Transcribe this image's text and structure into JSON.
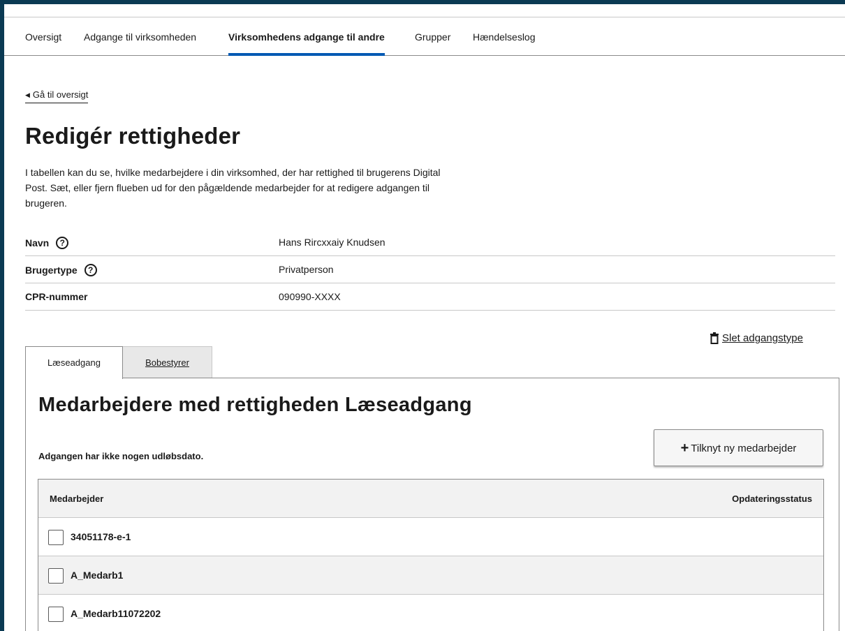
{
  "nav": {
    "tabs": [
      {
        "label": "Oversigt"
      },
      {
        "label": "Adgange til virksomheden"
      },
      {
        "label": "Virksomhedens adgange til andre"
      },
      {
        "label": "Grupper"
      },
      {
        "label": "Hændelseslog"
      }
    ],
    "active_index": 2
  },
  "back_link": "Gå til oversigt",
  "page_title": "Redigér rettigheder",
  "intro": "I tabellen kan du se, hvilke medarbejdere i din virksomhed, der har rettighed til brugerens Digital Post. Sæt, eller fjern flueben ud for den pågældende medarbejder for at redigere adgangen til brugeren.",
  "info": [
    {
      "label": "Navn",
      "value": "Hans Rircxxaiy Knudsen",
      "help": true
    },
    {
      "label": "Brugertype",
      "value": "Privatperson",
      "help": true
    },
    {
      "label": "CPR-nummer",
      "value": "090990-XXXX",
      "help": false
    }
  ],
  "delete_access_type": "Slet adgangstype",
  "access_tabs": [
    {
      "label": "Læseadgang",
      "active": true
    },
    {
      "label": "Bobestyrer",
      "active": false
    }
  ],
  "panel": {
    "title": "Medarbejdere med rettigheden Læseadgang",
    "note": "Adgangen har ikke nogen udløbsdato.",
    "add_button": "Tilknyt ny medarbejder",
    "table": {
      "columns": [
        "Medarbejder",
        "Opdateringsstatus"
      ],
      "rows": [
        {
          "name": "34051178-e-1",
          "checked": false
        },
        {
          "name": "A_Medarb1",
          "checked": false
        },
        {
          "name": "A_Medarb11072202",
          "checked": false
        }
      ]
    }
  },
  "icons": {
    "help": "help-circle-icon",
    "delete": "trash-icon",
    "back": "caret-left-icon",
    "add": "plus-icon"
  },
  "colors": {
    "accent": "#0059b3",
    "frame": "#0b3a53",
    "table_alt": "#f2f2f2"
  }
}
